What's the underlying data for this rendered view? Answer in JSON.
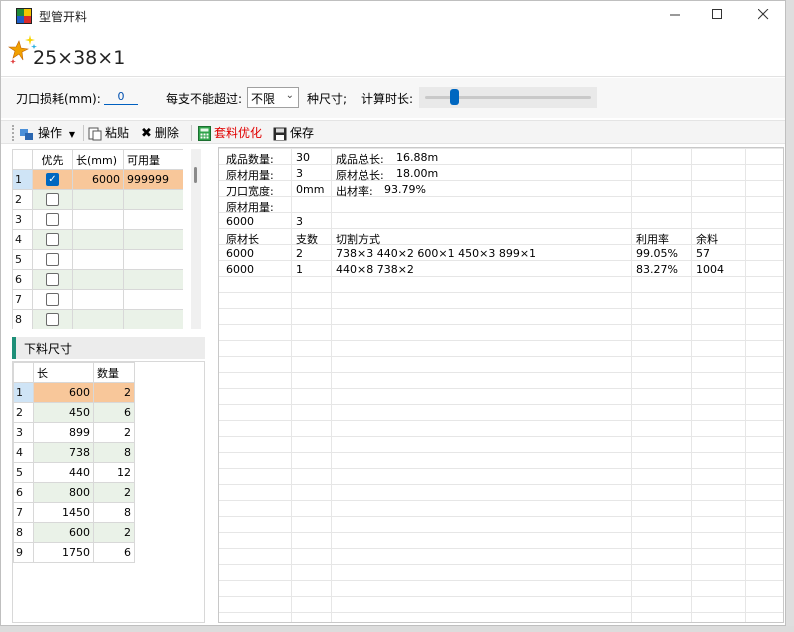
{
  "window": {
    "title": "型管开料"
  },
  "header": {
    "profile_title": "25×38×1"
  },
  "params": {
    "kerf_label": "刀口损耗(mm):",
    "kerf_value": "0",
    "max_label": "每支不能超过:",
    "max_value": "不限",
    "kinds_label": "种尺寸;",
    "calc_time_label": "计算时长:",
    "calc_time_level": 0.16
  },
  "toolbar": {
    "operate": "操作",
    "paste": "粘贴",
    "delete": "删除",
    "optimize": "套料优化",
    "save": "保存"
  },
  "stock_table": {
    "headers": [
      "优先",
      "长(mm)",
      "可用量"
    ],
    "rows": [
      {
        "n": "1",
        "checked": true,
        "length": "6000",
        "qty": "999999"
      },
      {
        "n": "2",
        "checked": false,
        "length": "",
        "qty": ""
      },
      {
        "n": "3",
        "checked": false,
        "length": "",
        "qty": ""
      },
      {
        "n": "4",
        "checked": false,
        "length": "",
        "qty": ""
      },
      {
        "n": "5",
        "checked": false,
        "length": "",
        "qty": ""
      },
      {
        "n": "6",
        "checked": false,
        "length": "",
        "qty": ""
      },
      {
        "n": "7",
        "checked": false,
        "length": "",
        "qty": ""
      },
      {
        "n": "8",
        "checked": false,
        "length": "",
        "qty": ""
      }
    ]
  },
  "cut_section": {
    "title": "下料尺寸"
  },
  "cut_table": {
    "headers": [
      "长",
      "数量"
    ],
    "rows": [
      {
        "n": "1",
        "length": "600",
        "qty": "2"
      },
      {
        "n": "2",
        "length": "450",
        "qty": "6"
      },
      {
        "n": "3",
        "length": "899",
        "qty": "2"
      },
      {
        "n": "4",
        "length": "738",
        "qty": "8"
      },
      {
        "n": "5",
        "length": "440",
        "qty": "12"
      },
      {
        "n": "6",
        "length": "800",
        "qty": "2"
      },
      {
        "n": "7",
        "length": "1450",
        "qty": "8"
      },
      {
        "n": "8",
        "length": "600",
        "qty": "2"
      },
      {
        "n": "9",
        "length": "1750",
        "qty": "6"
      }
    ]
  },
  "result": {
    "summary": {
      "product_qty_label": "成品数量:",
      "product_qty": "30",
      "product_total_label": "成品总长:",
      "product_total": "16.88m",
      "raw_used_label": "原材用量:",
      "raw_used": "3",
      "raw_total_label": "原材总长:",
      "raw_total": "18.00m",
      "kerf_label": "刀口宽度:",
      "kerf": "0mm",
      "yield_label": "出材率:",
      "yield": "93.79%",
      "raw_usage_label": "原材用量:",
      "usage_length": "6000",
      "usage_count": "3"
    },
    "plan_headers": {
      "raw_len": "原材长",
      "count": "支数",
      "method": "切割方式",
      "util": "利用率",
      "remain": "余料"
    },
    "plans": [
      {
        "raw_len": "6000",
        "count": "2",
        "method": "738×3  440×2  600×1  450×3  899×1",
        "util": "99.05%",
        "remain": "57"
      },
      {
        "raw_len": "6000",
        "count": "1",
        "method": "440×8  738×2",
        "util": "83.27%",
        "remain": "1004"
      }
    ]
  },
  "colors": {
    "accent": "#0067c0",
    "selected_row": "#f8c79a",
    "alt_row": "#eaf2e8",
    "section_bar": "#1e8f78",
    "optimize_text": "#e00000"
  }
}
